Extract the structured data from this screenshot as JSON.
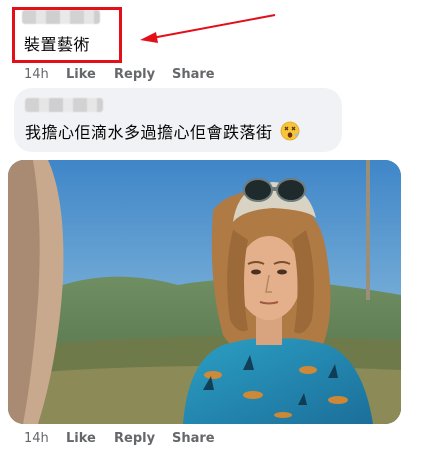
{
  "top_comment": {
    "author_redacted": true,
    "text": "裝置藝術",
    "time": "14h",
    "like": "Like",
    "reply": "Reply",
    "share": "Share"
  },
  "reply_comment": {
    "author_redacted": true,
    "text": "我擔心佢滴水多過擔心佢會跌落街",
    "emoji": "😵",
    "time": "14h",
    "like": "Like",
    "reply": "Reply",
    "share": "Share"
  },
  "colors": {
    "highlight": "#e3101a",
    "bubble": "#f0f2f5",
    "meta_text": "#65676b"
  },
  "icons": [
    "red-arrow-annotation",
    "dizzy-face-emoji"
  ]
}
